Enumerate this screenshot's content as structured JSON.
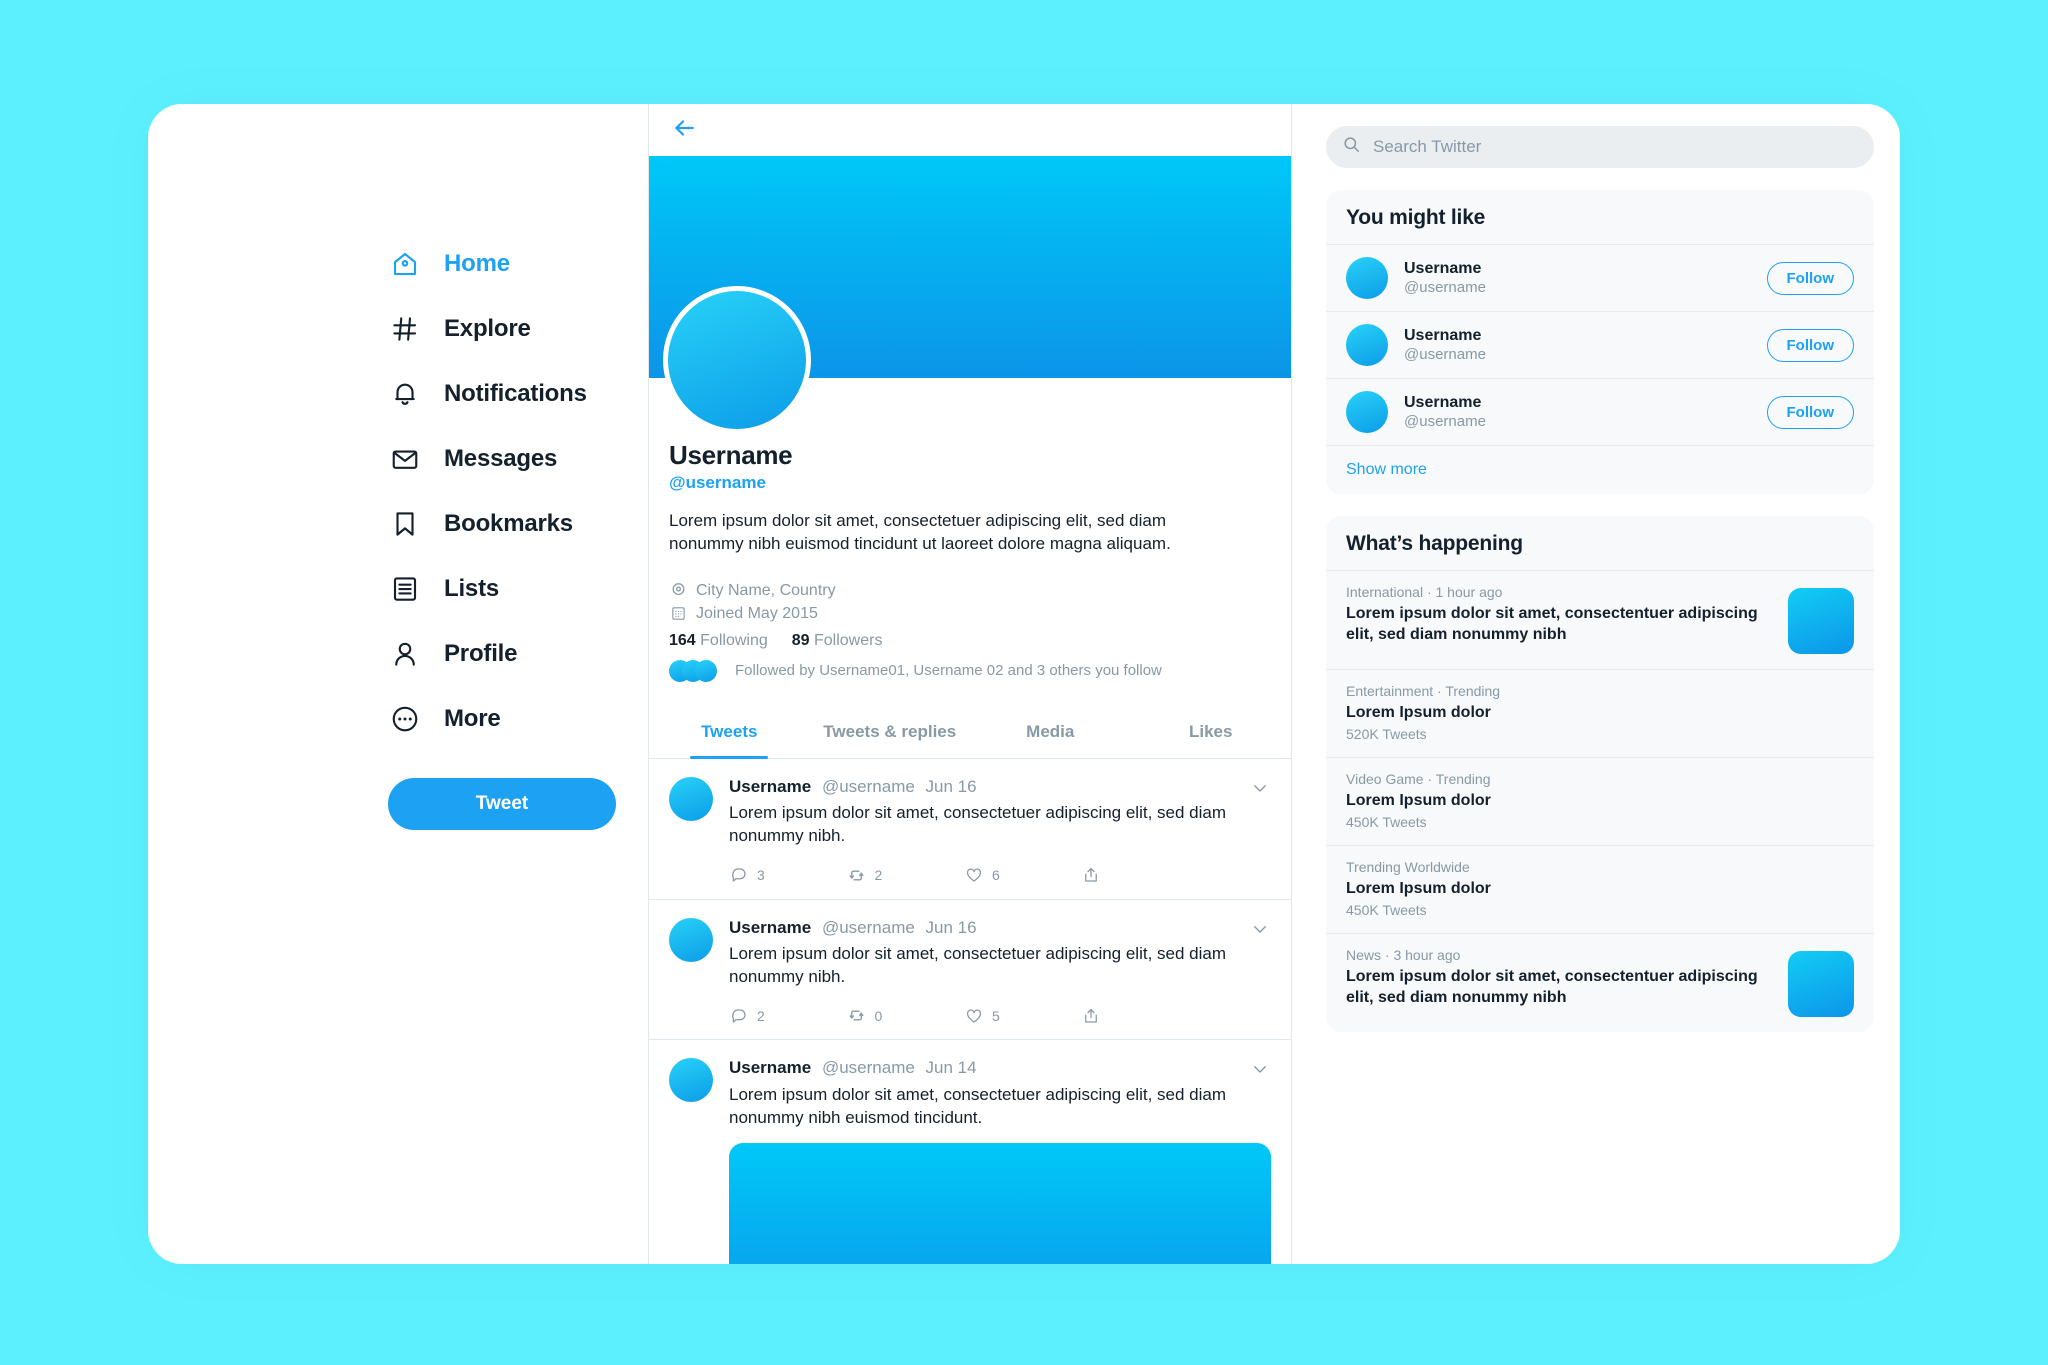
{
  "theme": {
    "page_background": "#5CF0FF",
    "accent": "#1DA1F2",
    "text_primary": "#14202B",
    "text_muted": "#8899A6",
    "card_background": "#F7F9FA"
  },
  "sidebar": {
    "items": [
      {
        "label": "Home",
        "icon": "home-icon",
        "active": true
      },
      {
        "label": "Explore",
        "icon": "hashtag-icon",
        "active": false
      },
      {
        "label": "Notifications",
        "icon": "bell-icon",
        "active": false
      },
      {
        "label": "Messages",
        "icon": "envelope-icon",
        "active": false
      },
      {
        "label": "Bookmarks",
        "icon": "bookmark-icon",
        "active": false
      },
      {
        "label": "Lists",
        "icon": "list-icon",
        "active": false
      },
      {
        "label": "Profile",
        "icon": "person-icon",
        "active": false
      },
      {
        "label": "More",
        "icon": "ellipsis-circle-icon",
        "active": false
      }
    ],
    "tweet_button_label": "Tweet"
  },
  "center": {
    "back_icon": "back-arrow-icon",
    "profile": {
      "name": "Username",
      "handle": "@username",
      "bio": "Lorem ipsum dolor sit amet, consectetuer adipiscing elit, sed diam nonummy nibh euismod tincidunt ut laoreet dolore magna aliquam.",
      "location": "City Name, Country",
      "location_icon": "location-pin-icon",
      "joined": "Joined May 2015",
      "joined_icon": "calendar-icon",
      "following_count": "164",
      "following_label": "Following",
      "followers_count": "89",
      "followers_label": "Followers",
      "followed_by": "Followed by Username01, Username 02 and 3 others you follow"
    },
    "tabs": [
      {
        "label": "Tweets",
        "active": true
      },
      {
        "label": "Tweets & replies",
        "active": false
      },
      {
        "label": "Media",
        "active": false
      },
      {
        "label": "Likes",
        "active": false
      }
    ],
    "tweets": [
      {
        "name": "Username",
        "handle": "@username",
        "date": "Jun 16",
        "text": "Lorem ipsum dolor sit amet, consectetuer adipiscing elit, sed diam nonummy nibh.",
        "replies": "3",
        "retweets": "2",
        "likes": "6",
        "has_media": false
      },
      {
        "name": "Username",
        "handle": "@username",
        "date": "Jun 16",
        "text": "Lorem ipsum dolor sit amet, consectetuer adipiscing elit, sed diam nonummy nibh.",
        "replies": "2",
        "retweets": "0",
        "likes": "5",
        "has_media": false
      },
      {
        "name": "Username",
        "handle": "@username",
        "date": "Jun 14",
        "text": "Lorem ipsum dolor sit amet, consectetuer adipiscing elit, sed diam nonummy nibh euismod tincidunt.",
        "replies": "",
        "retweets": "",
        "likes": "",
        "has_media": true
      }
    ]
  },
  "rightbar": {
    "search": {
      "placeholder": "Search Twitter",
      "value": "",
      "icon": "search-icon"
    },
    "you_might_like": {
      "title": "You might like",
      "suggestions": [
        {
          "name": "Username",
          "handle": "@username",
          "follow_label": "Follow"
        },
        {
          "name": "Username",
          "handle": "@username",
          "follow_label": "Follow"
        },
        {
          "name": "Username",
          "handle": "@username",
          "follow_label": "Follow"
        }
      ],
      "show_more_label": "Show more"
    },
    "whats_happening": {
      "title": "What’s happening",
      "trends": [
        {
          "category": "International · 1 hour ago",
          "title": "Lorem ipsum dolor sit amet, consectentuer adipiscing elit, sed diam nonummy nibh",
          "count": "",
          "has_thumb": true
        },
        {
          "category": "Entertainment · Trending",
          "title": "Lorem Ipsum dolor",
          "count": "520K Tweets",
          "has_thumb": false
        },
        {
          "category": "Video Game · Trending",
          "title": "Lorem Ipsum dolor",
          "count": "450K Tweets",
          "has_thumb": false
        },
        {
          "category": "Trending Worldwide",
          "title": "Lorem Ipsum dolor",
          "count": "450K Tweets",
          "has_thumb": false
        },
        {
          "category": "News · 3 hour ago",
          "title": "Lorem ipsum dolor sit amet, consectentuer adipiscing elit, sed diam nonummy nibh",
          "count": "",
          "has_thumb": true
        }
      ]
    }
  }
}
